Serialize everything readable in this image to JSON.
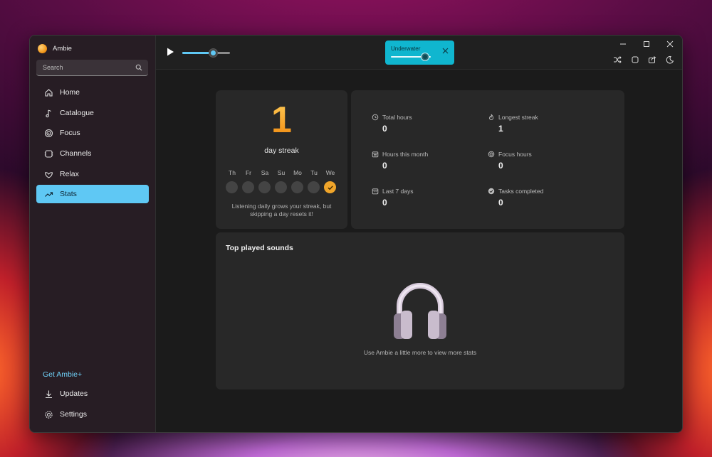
{
  "app": {
    "name": "Ambie"
  },
  "search": {
    "placeholder": "Search"
  },
  "sidebar": {
    "items": [
      {
        "label": "Home",
        "icon": "home-icon"
      },
      {
        "label": "Catalogue",
        "icon": "music-note-icon"
      },
      {
        "label": "Focus",
        "icon": "target-icon"
      },
      {
        "label": "Channels",
        "icon": "channels-icon"
      },
      {
        "label": "Relax",
        "icon": "relax-icon"
      },
      {
        "label": "Stats",
        "icon": "trend-icon",
        "active": true
      }
    ],
    "get_plus": "Get Ambie+",
    "footer": [
      {
        "label": "Updates",
        "icon": "download-icon"
      },
      {
        "label": "Settings",
        "icon": "gear-icon"
      }
    ]
  },
  "player": {
    "volume": 0.65,
    "sound_name": "Underwater",
    "sound_volume": 0.85
  },
  "streak": {
    "count": "1",
    "label": "day streak",
    "days": [
      "Th",
      "Fr",
      "Sa",
      "Su",
      "Mo",
      "Tu",
      "We"
    ],
    "completed": [
      false,
      false,
      false,
      false,
      false,
      false,
      true
    ],
    "note": "Listening daily grows your streak, but skipping a day resets it!"
  },
  "stats": [
    {
      "label": "Total hours",
      "value": "0",
      "icon": "clock-user-icon"
    },
    {
      "label": "Longest streak",
      "value": "1",
      "icon": "flame-icon"
    },
    {
      "label": "Hours this month",
      "value": "0",
      "icon": "calendar-month-icon"
    },
    {
      "label": "Focus hours",
      "value": "0",
      "icon": "focus-target-icon"
    },
    {
      "label": "Last 7 days",
      "value": "0",
      "icon": "calendar-week-icon"
    },
    {
      "label": "Tasks completed",
      "value": "0",
      "icon": "check-circle-icon"
    }
  ],
  "top_played": {
    "title": "Top played sounds",
    "empty_note": "Use Ambie a little more to view more stats",
    "icon": "headphones-icon"
  },
  "colors": {
    "accent": "#5fc8f4",
    "streak": "#f0a52a",
    "chip": "#10b6cf"
  }
}
